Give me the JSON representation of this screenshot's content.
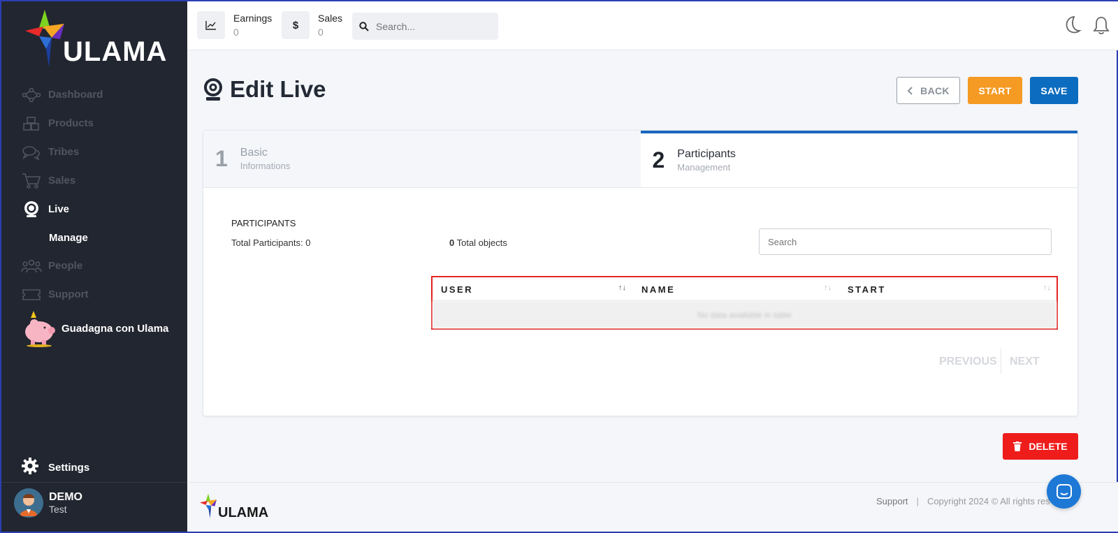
{
  "brand": {
    "name": "ULAMA"
  },
  "sidebar": {
    "items": [
      {
        "label": "Dashboard",
        "icon": "network-icon",
        "active": false
      },
      {
        "label": "Products",
        "icon": "boxes-icon",
        "active": false
      },
      {
        "label": "Tribes",
        "icon": "chat-bubbles-icon",
        "active": false
      },
      {
        "label": "Sales",
        "icon": "cart-icon",
        "active": false
      },
      {
        "label": "Live",
        "icon": "webcam-icon",
        "active": true
      }
    ],
    "sub_item": "Manage",
    "items_after": [
      {
        "label": "People",
        "icon": "people-icon"
      },
      {
        "label": "Support",
        "icon": "ticket-icon"
      }
    ],
    "promo_label": "Guadagna con Ulama",
    "settings_label": "Settings",
    "user": {
      "name": "DEMO",
      "sub": "Test"
    }
  },
  "topbar": {
    "earnings_label": "Earnings",
    "earnings_value": "0",
    "sales_label": "Sales",
    "sales_value": "0",
    "search_placeholder": "Search..."
  },
  "page": {
    "title": "Edit Live",
    "back_label": "BACK",
    "start_label": "START",
    "save_label": "SAVE",
    "delete_label": "DELETE"
  },
  "steps": [
    {
      "num": "1",
      "title": "Basic",
      "sub": "Informations",
      "active": false
    },
    {
      "num": "2",
      "title": "Participants",
      "sub": "Management",
      "active": true
    }
  ],
  "participants": {
    "heading": "PARTICIPANTS",
    "total_label": "Total Participants: 0",
    "total_objects_num": "0",
    "total_objects_label": " Total objects",
    "search_placeholder": "Search",
    "columns": [
      "USER",
      "NAME",
      "START"
    ],
    "empty_text": "No data available in table",
    "previous_label": "PREVIOUS",
    "next_label": "NEXT"
  },
  "footer": {
    "support_label": "Support",
    "separator": "|",
    "copyright": "Copyright 2024 © All rights res"
  },
  "colors": {
    "sidebar_bg": "#222630",
    "accent_blue": "#0c6cbf",
    "start_orange": "#f59a23",
    "delete_red": "#ef1c1c",
    "highlight_red": "#e32424"
  }
}
